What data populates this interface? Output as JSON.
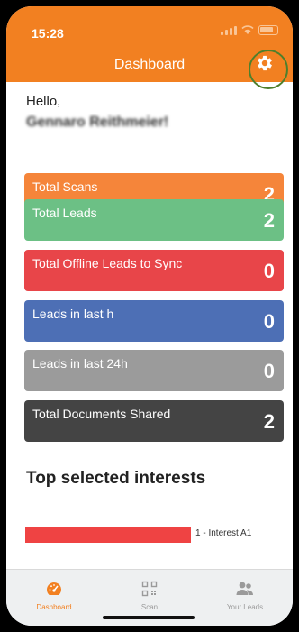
{
  "status_bar": {
    "time": "15:28"
  },
  "header": {
    "title": "Dashboard"
  },
  "greeting": {
    "hello": "Hello,",
    "name": "Gennaro Reithmeier!"
  },
  "cards": [
    {
      "label": "Total Scans",
      "value": "2",
      "color": "#f5853a"
    },
    {
      "label": "Total Leads",
      "value": "2",
      "color": "#6cc085"
    },
    {
      "label": "Total Offline Leads to Sync",
      "value": "0",
      "color": "#e84549"
    },
    {
      "label": "Leads in last h",
      "value": "0",
      "color": "#4d6fb5"
    },
    {
      "label": "Leads in last 24h",
      "value": "0",
      "color": "#9b9b9b"
    },
    {
      "label": "Total Documents Shared",
      "value": "2",
      "color": "#444444"
    }
  ],
  "interests": {
    "heading": "Top selected interests",
    "items": [
      {
        "label": "1 - Interest A1",
        "share": 1.0,
        "color": "#ef4343"
      }
    ]
  },
  "tabbar": {
    "tabs": [
      {
        "label": "Dashboard",
        "icon": "speedometer-icon",
        "active": true
      },
      {
        "label": "Scan",
        "icon": "qr-code-icon",
        "active": false
      },
      {
        "label": "Your Leads",
        "icon": "people-icon",
        "active": false
      }
    ],
    "active_color": "#f28021",
    "inactive_color": "#9a9a9a"
  }
}
